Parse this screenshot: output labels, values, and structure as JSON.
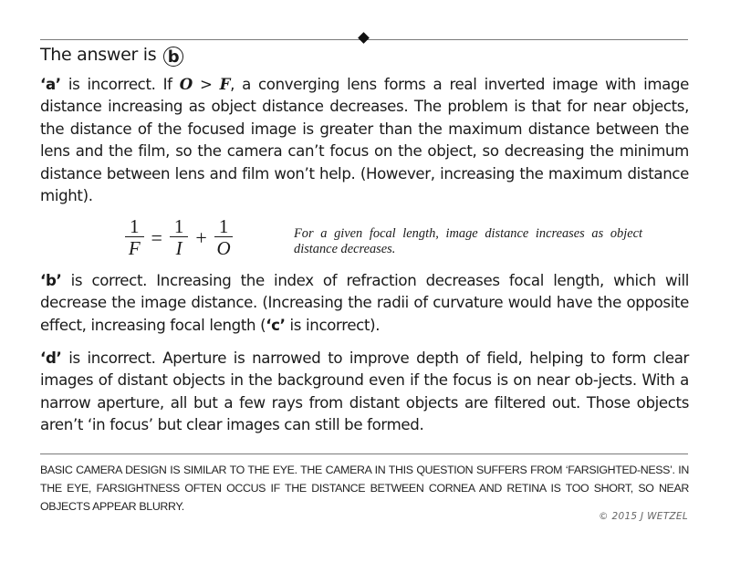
{
  "answer": {
    "prefix": "The answer is",
    "letter": "b"
  },
  "paragraphs": {
    "a": {
      "option": "‘a’",
      "text_1": " is incorrect.  If ",
      "math_O": "O",
      "gt": " > ",
      "math_F": "F",
      "text_2": ", a converging lens forms a real inverted image with image distance increasing as object distance decreases.  The problem is that for near objects, the distance of the focused image is greater than the maximum distance between the lens and the film, so the camera can’t focus on the object, so decreasing the minimum distance between lens and film won’t help.  (However, increasing the maximum distance might)."
    },
    "b": {
      "option": "‘b’",
      "text_1": " is correct.  Increasing the index of refraction decreases focal length, which will decrease the image distance.  (Increasing the radii of curvature would have the opposite effect, increasing focal length (",
      "option_c": "‘c’",
      "text_2": " is incorrect)."
    },
    "d": {
      "option": "‘d’",
      "text_1": " is incorrect.  Aperture is narrowed to improve depth of field, helping to form clear images of distant objects in the background even if the focus is on near ob-jects.  With a narrow aperture, all but a few rays from distant objects are filtered out.  Those objects aren’t ‘in focus’ but clear images can still be formed."
    }
  },
  "equation": {
    "lhs_num": "1",
    "lhs_den": "F",
    "equals": "=",
    "term1_num": "1",
    "term1_den": "I",
    "plus": "+",
    "term2_num": "1",
    "term2_den": "O",
    "note": "For a given focal length, image distance increases as object distance decreases."
  },
  "footnote": "BASIC CAMERA DESIGN IS SIMILAR TO THE EYE.  THE CAMERA IN THIS QUESTION SUFFERS FROM ‘FARSIGHTED-NESS’.  IN THE EYE, FARSIGHTNESS OFTEN OCCUS IF THE DISTANCE BETWEEN CORNEA AND RETINA IS TOO SHORT, SO NEAR OBJECTS APPEAR BLURRY.",
  "copyright": "© 2015 J WETZEL"
}
